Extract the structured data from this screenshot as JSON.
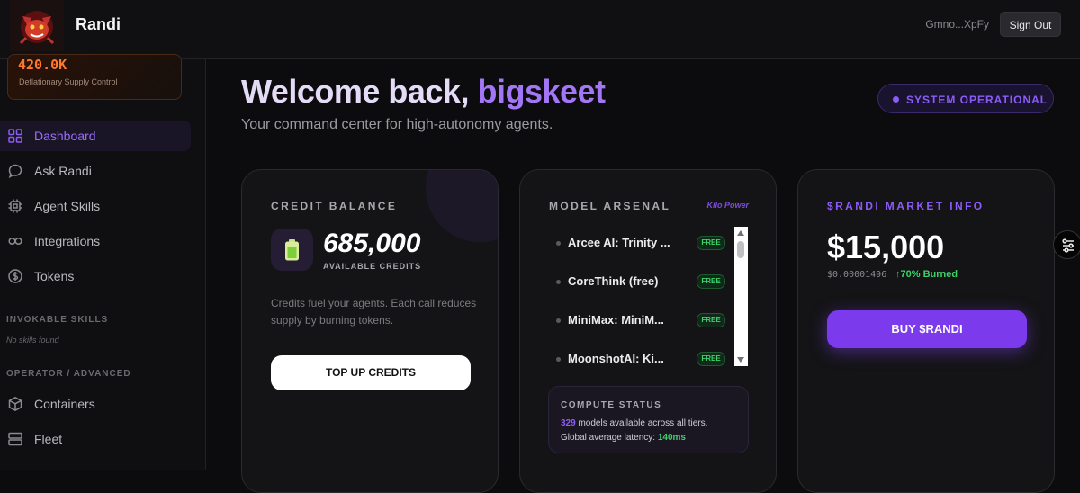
{
  "app": {
    "name": "Randi",
    "logo": "devil-mascot-logo"
  },
  "header": {
    "wallet": "Gmno...XpFy",
    "sign_out": "Sign Out"
  },
  "sidebar": {
    "supply": {
      "value": "420.0K",
      "label": "Deflationary Supply Control"
    },
    "nav": [
      {
        "label": "Dashboard",
        "icon": "grid-icon",
        "active": true
      },
      {
        "label": "Ask Randi",
        "icon": "chat-icon"
      },
      {
        "label": "Agent Skills",
        "icon": "chip-icon"
      },
      {
        "label": "Integrations",
        "icon": "link-icon"
      },
      {
        "label": "Tokens",
        "icon": "dollar-icon"
      }
    ],
    "invokable_title": "INVOKABLE SKILLS",
    "no_skills": "No skills found",
    "operator_title": "OPERATOR / ADVANCED",
    "operator_nav": [
      {
        "label": "Containers",
        "icon": "box-icon"
      },
      {
        "label": "Fleet",
        "icon": "server-icon"
      }
    ]
  },
  "welcome": {
    "prefix": "Welcome back, ",
    "user": "bigskeet",
    "subtitle": "Your command center for high-autonomy agents."
  },
  "status": {
    "label": "SYSTEM OPERATIONAL"
  },
  "credit": {
    "title": "CREDIT BALANCE",
    "value": "685,000",
    "label": "AVAILABLE CREDITS",
    "desc": "Credits fuel your agents. Each call reduces supply by burning tokens.",
    "button": "TOP UP CREDITS"
  },
  "arsenal": {
    "title": "MODEL ARSENAL",
    "badge": "Kilo Power",
    "models": [
      {
        "name": "Arcee AI: Trinity ...",
        "tag": "FREE"
      },
      {
        "name": "CoreThink (free)",
        "tag": "FREE"
      },
      {
        "name": "MiniMax: MiniM...",
        "tag": "FREE"
      },
      {
        "name": "MoonshotAI: Ki...",
        "tag": "FREE"
      }
    ],
    "compute": {
      "title": "COMPUTE STATUS",
      "models_count": "329",
      "models_text": " models available across all tiers.",
      "latency_text": "Global average latency: ",
      "latency": "140ms"
    }
  },
  "market": {
    "title": "$RANDI MARKET INFO",
    "price": "$15,000",
    "subprice": "$0.00001496",
    "burned": "↑70% Burned",
    "button": "BUY $RANDI"
  },
  "colors": {
    "accent": "#8b5cf6",
    "success": "#3ed16a",
    "orange": "#ff7a2e"
  }
}
